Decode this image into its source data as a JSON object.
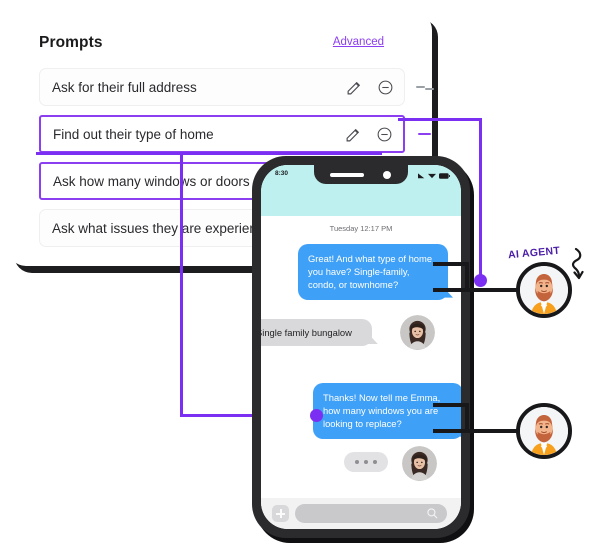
{
  "card": {
    "title": "Prompts",
    "advanced_label": "Advanced",
    "rows": [
      {
        "label": "Ask for their full address",
        "selected": false,
        "edit_icon": "pencil-icon",
        "remove_icon": "minus-circle-icon",
        "handle_icon": "drag-handle-icon"
      },
      {
        "label": "Find out their type of home",
        "selected": true,
        "edit_icon": "pencil-icon",
        "remove_icon": "minus-circle-icon",
        "handle_icon": "drag-handle-icon"
      },
      {
        "label": "Ask how many windows or doors",
        "selected": true,
        "edit_icon": "pencil-icon",
        "remove_icon": "minus-circle-icon",
        "handle_icon": "drag-handle-icon"
      },
      {
        "label": "Ask what issues they are experiencing",
        "selected": false,
        "edit_icon": "pencil-icon",
        "remove_icon": "minus-circle-icon",
        "handle_icon": "drag-handle-icon"
      }
    ]
  },
  "phone": {
    "status_time": "8:30",
    "status_icons": [
      "signal-icon",
      "wifi-icon",
      "battery-icon"
    ],
    "day_stamp": "Tuesday 12:17 PM",
    "messages": [
      {
        "from": "agent",
        "text": "Great! And what type of home you have? Single-family, condo, or townhome?"
      },
      {
        "from": "user",
        "text": "Single family bungalow"
      },
      {
        "from": "agent",
        "text": "Thanks! Now tell me Emma, how many windows you are looking to replace?"
      },
      {
        "from": "user",
        "text": "..."
      }
    ],
    "composer": {
      "add_icon": "plus-icon",
      "search_icon": "search-icon",
      "placeholder": ""
    }
  },
  "annotations": {
    "ai_agent_label": "AI AGENT",
    "arrow_icon": "curved-arrow-icon",
    "agent_avatar_icon": "bearded-man-avatar",
    "user_avatar_icon": "woman-avatar"
  },
  "colors": {
    "accent_purple": "#7b2ff2",
    "link_purple": "#8b3ff0",
    "bubble_blue": "#3fa0f7",
    "bubble_gray": "#d9d9db",
    "header_teal": "#bdf0ef",
    "outline_dark": "#18181a"
  }
}
